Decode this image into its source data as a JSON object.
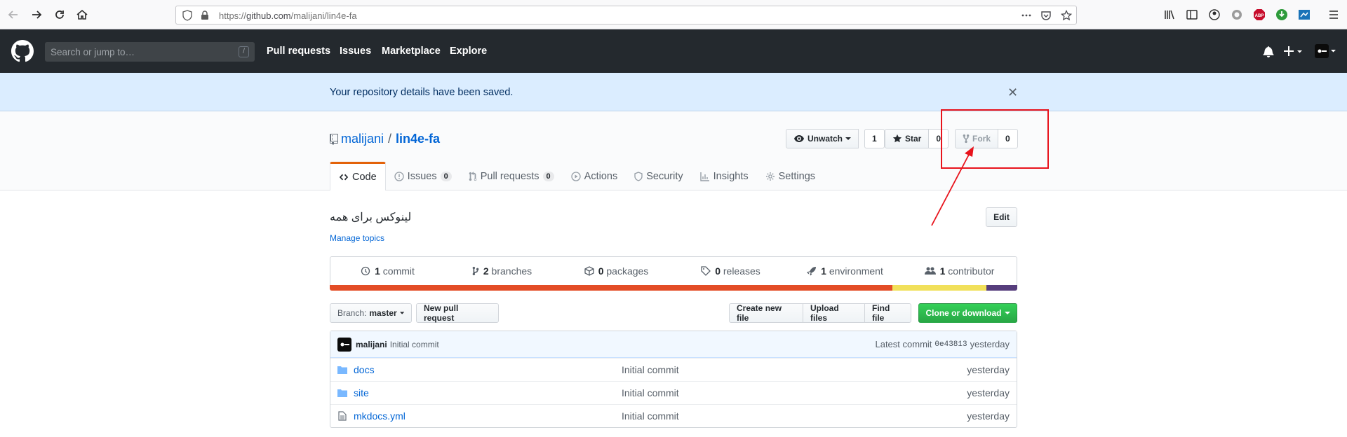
{
  "browser": {
    "url_prefix": "https://",
    "url_host": "github.com",
    "url_path": "/malijani/lin4e-fa",
    "page_actions_icon": "ellipsis-icon"
  },
  "header": {
    "search_placeholder": "Search or jump to…",
    "search_key": "/",
    "nav": [
      "Pull requests",
      "Issues",
      "Marketplace",
      "Explore"
    ]
  },
  "flash": {
    "message": "Your repository details have been saved.",
    "close": "✕"
  },
  "repo": {
    "owner": "malijani",
    "separator": "/",
    "name": "lin4e-fa",
    "unwatch_label": "Unwatch",
    "watch_count": "1",
    "star_label": "Star",
    "star_count": "0",
    "fork_label": "Fork",
    "fork_count": "0"
  },
  "tabs": [
    {
      "label": "Code"
    },
    {
      "label": "Issues",
      "count": "0"
    },
    {
      "label": "Pull requests",
      "count": "0"
    },
    {
      "label": "Actions"
    },
    {
      "label": "Security"
    },
    {
      "label": "Insights"
    },
    {
      "label": "Settings"
    }
  ],
  "about": {
    "description": "لینوکس برای همه",
    "manage_topics": "Manage topics",
    "edit_label": "Edit"
  },
  "summary": [
    {
      "num": "1",
      "label": "commit"
    },
    {
      "num": "2",
      "label": "branches"
    },
    {
      "num": "0",
      "label": "packages"
    },
    {
      "num": "0",
      "label": "releases"
    },
    {
      "num": "1",
      "label": "environment"
    },
    {
      "num": "1",
      "label": "contributor"
    }
  ],
  "languages": [
    {
      "color": "#e34c26",
      "fraction": 0.818
    },
    {
      "color": "#f1e05a",
      "fraction": 0.137
    },
    {
      "color": "#563d7c",
      "fraction": 0.045
    }
  ],
  "toolbar": {
    "branch_prefix": "Branch:",
    "branch_name": "master",
    "new_pr": "New pull request",
    "create_file": "Create new file",
    "upload_files": "Upload files",
    "find_file": "Find file",
    "clone": "Clone or download"
  },
  "latest_commit": {
    "author": "malijani",
    "message": "Initial commit",
    "prefix": "Latest commit",
    "sha": "0e43813",
    "age": "yesterday"
  },
  "files": [
    {
      "name": "docs",
      "type": "folder",
      "message": "Initial commit",
      "age": "yesterday"
    },
    {
      "name": "site",
      "type": "folder",
      "message": "Initial commit",
      "age": "yesterday"
    },
    {
      "name": "mkdocs.yml",
      "type": "file",
      "message": "Initial commit",
      "age": "yesterday"
    }
  ],
  "colors": {
    "annotation": "#e8131c",
    "link": "#0366d6",
    "header_bg": "#24292e",
    "flash_bg": "#dbedff",
    "green": "#28a745"
  }
}
